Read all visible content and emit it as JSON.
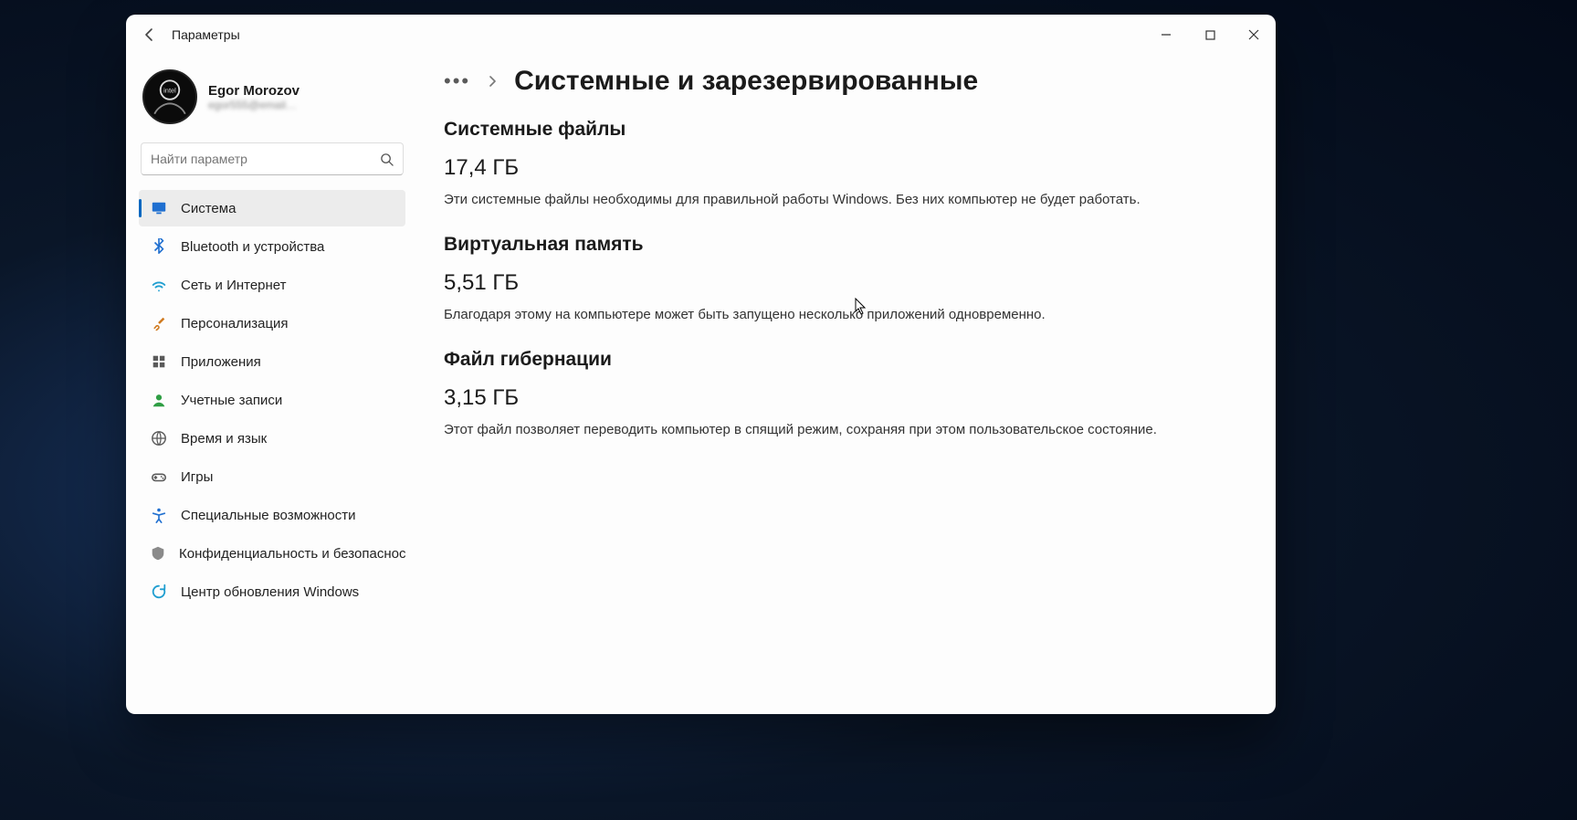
{
  "window": {
    "title": "Параметры"
  },
  "profile": {
    "name": "Egor Morozov",
    "email_masked": "egor555@email…"
  },
  "search": {
    "placeholder": "Найти параметр"
  },
  "nav": {
    "items": [
      {
        "id": "system",
        "label": "Система",
        "icon": "monitor",
        "color": "#1f6fd0",
        "selected": true
      },
      {
        "id": "bluetooth",
        "label": "Bluetooth и устройства",
        "icon": "bluetooth",
        "color": "#1f6fd0"
      },
      {
        "id": "network",
        "label": "Сеть и Интернет",
        "icon": "wifi",
        "color": "#1f9ed0"
      },
      {
        "id": "personalize",
        "label": "Персонализация",
        "icon": "brush",
        "color": "#d07a1f"
      },
      {
        "id": "apps",
        "label": "Приложения",
        "icon": "apps",
        "color": "#5a5a5a"
      },
      {
        "id": "accounts",
        "label": "Учетные записи",
        "icon": "person",
        "color": "#2f9e44"
      },
      {
        "id": "timelang",
        "label": "Время и язык",
        "icon": "globe",
        "color": "#5a5a5a"
      },
      {
        "id": "gaming",
        "label": "Игры",
        "icon": "gamepad",
        "color": "#5a5a5a"
      },
      {
        "id": "a11y",
        "label": "Специальные возможности",
        "icon": "a11y",
        "color": "#1f6fd0"
      },
      {
        "id": "privacy",
        "label": "Конфиденциальность и безопасность",
        "icon": "shield",
        "color": "#8a8a8a"
      },
      {
        "id": "update",
        "label": "Центр обновления Windows",
        "icon": "update",
        "color": "#1f9ed0"
      }
    ]
  },
  "breadcrumb": {
    "title": "Системные и зарезервированные"
  },
  "sections": [
    {
      "heading": "Системные файлы",
      "value": "17,4 ГБ",
      "desc": "Эти системные файлы необходимы для правильной работы Windows. Без них компьютер не будет работать."
    },
    {
      "heading": "Виртуальная память",
      "value": "5,51 ГБ",
      "desc": "Благодаря этому на компьютере может быть запущено несколько приложений одновременно."
    },
    {
      "heading": "Файл гибернации",
      "value": "3,15 ГБ",
      "desc": "Этот файл позволяет переводить компьютер в спящий режим, сохраняя при этом пользовательское состояние."
    }
  ]
}
